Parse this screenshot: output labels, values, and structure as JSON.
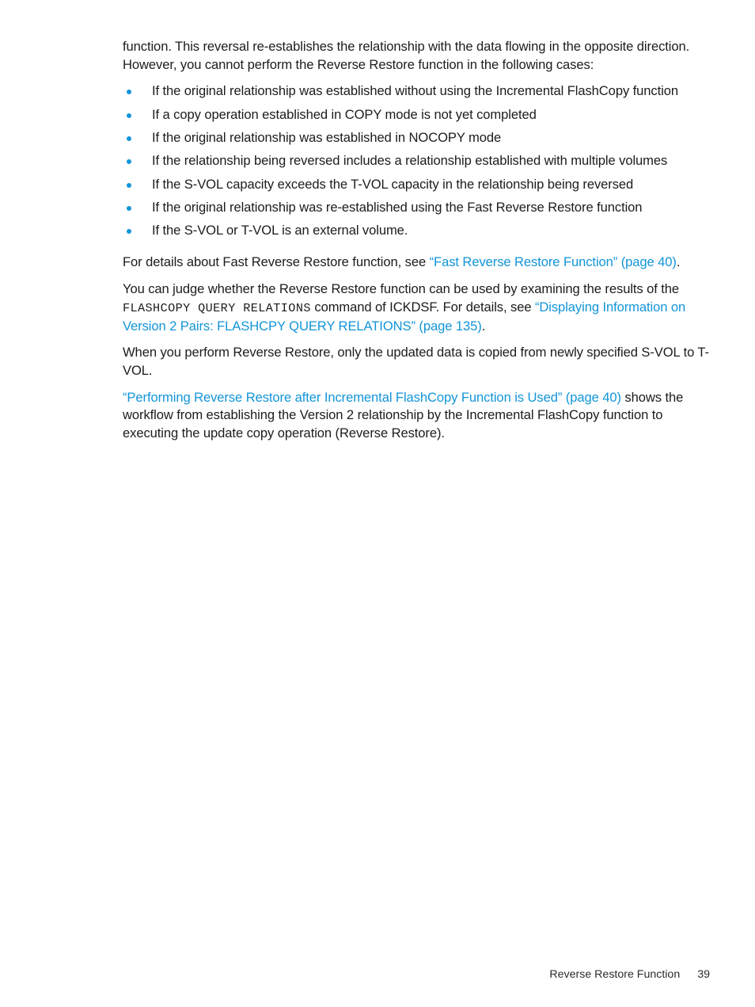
{
  "document": {
    "background_color": "#ffffff",
    "body_text_color": "#1c1c1c",
    "link_color": "#1295d8",
    "bullet_color": "#1295d8"
  },
  "intro": {
    "paragraph": "function. This reversal re-establishes the relationship with the data flowing in the opposite direction. However, you cannot perform the Reverse Restore function in the following cases:"
  },
  "restrictions_list": [
    "If the original relationship was established without using the Incremental FlashCopy function",
    "If a copy operation established in COPY mode is not yet completed",
    "If the original relationship was established in NOCOPY mode",
    "If the relationship being reversed includes a relationship established with multiple volumes",
    "If the S-VOL capacity exceeds the T-VOL capacity in the relationship being reversed",
    "If the original relationship was re-established using the Fast Reverse Restore function",
    "If the S-VOL or T-VOL is an external volume."
  ],
  "details_paragraph": {
    "lead": "For details about Fast Reverse Restore function, see ",
    "link": "“Fast Reverse Restore Function” (page 40)",
    "trail": "."
  },
  "judge_paragraph": {
    "part1": "You can judge whether the Reverse Restore function can be used by examining the results of the ",
    "command": "FLASHCOPY QUERY RELATIONS",
    "part2": " command of ICKDSF. For details, see ",
    "link": "“Displaying Information on Version 2 Pairs: FLASHCPY QUERY RELATIONS” (page 135)",
    "part3": "."
  },
  "perform_paragraph": {
    "text": "When you perform Reverse Restore, only the updated data is copied from newly specified S-VOL to T-VOL."
  },
  "workflow_paragraph": {
    "link": "“Performing Reverse Restore after Incremental FlashCopy Function is Used” (page 40)",
    "trail": " shows the workflow from establishing the Version 2 relationship by the Incremental FlashCopy function to executing the update copy operation (Reverse Restore)."
  },
  "footer": {
    "chapter_label": "Reverse Restore Function",
    "page_number": "39"
  }
}
